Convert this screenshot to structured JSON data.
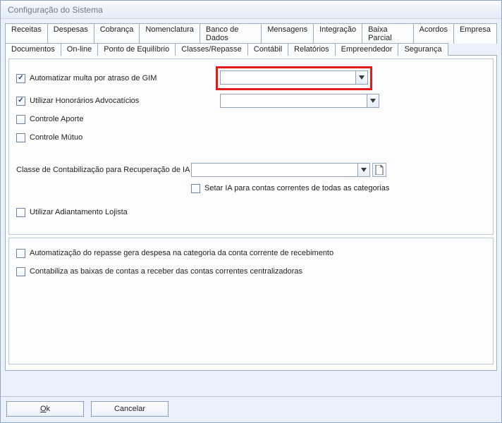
{
  "window": {
    "title": "Configuração do Sistema"
  },
  "tabs_row1": [
    "Receitas",
    "Despesas",
    "Cobrança",
    "Nomenclatura",
    "Banco de Dados",
    "Mensagens",
    "Integração",
    "Baixa Parcial",
    "Acordos",
    "Empresa"
  ],
  "tabs_row2": [
    "Documentos",
    "On-line",
    "Ponto de Equilíbrio",
    "Classes/Repasse",
    "Contábil",
    "Relatórios",
    "Empreendedor",
    "Segurança"
  ],
  "active_tab": "Classes/Repasse",
  "panel1": {
    "chk_gim": {
      "label": "Automatizar multa por atraso de GIM",
      "checked": true
    },
    "combo_gim": "",
    "chk_honorarios": {
      "label": "Utilizar Honorários Advocatícios",
      "checked": true
    },
    "combo_honorarios": "",
    "chk_aporte": {
      "label": "Controle Aporte",
      "checked": false
    },
    "chk_mutuo": {
      "label": "Controle Mútuo",
      "checked": false
    },
    "lbl_classe_ia": "Classe de Contabilização para Recuperação de IA",
    "combo_classe_ia": "",
    "chk_setar_ia": {
      "label": "Setar IA para contas correntes de todas as categorias",
      "checked": false
    },
    "chk_adiantamento": {
      "label": "Utilizar Adiantamento Lojista",
      "checked": false
    }
  },
  "panel2": {
    "chk_auto_repasse": {
      "label": "Automatização do repasse gera despesa na categoria da conta corrente de recebimento",
      "checked": false
    },
    "chk_contabiliza_baixas": {
      "label": "Contabiliza as baixas de contas a receber das contas correntes centralizadoras",
      "checked": false
    }
  },
  "buttons": {
    "ok": "Ok",
    "cancel": "Cancelar"
  }
}
